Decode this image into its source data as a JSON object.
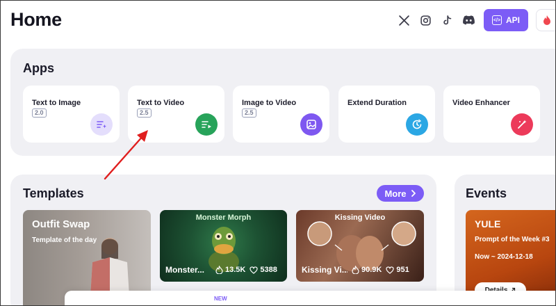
{
  "page": {
    "title": "Home"
  },
  "header": {
    "socials": [
      {
        "name": "x-icon"
      },
      {
        "name": "instagram-icon"
      },
      {
        "name": "tiktok-icon"
      },
      {
        "name": "discord-icon"
      }
    ],
    "api_label": "API"
  },
  "apps": {
    "title": "Apps",
    "items": [
      {
        "label": "Text to Image",
        "version": "2.0",
        "icon": "text-image-icon",
        "color": "#e4defc"
      },
      {
        "label": "Text to Video",
        "version": "2.5",
        "icon": "text-video-icon",
        "color": "#27a35a"
      },
      {
        "label": "Image to Video",
        "version": "2.5",
        "icon": "image-video-icon",
        "color": "#7e58f0"
      },
      {
        "label": "Extend Duration",
        "version": "",
        "icon": "extend-icon",
        "color": "#2ba7e4"
      },
      {
        "label": "Video Enhancer",
        "version": "",
        "icon": "enhance-icon",
        "color": "#ec3a5a"
      }
    ]
  },
  "templates": {
    "title": "Templates",
    "more_label": "More",
    "featured": {
      "title": "Outfit Swap",
      "subtitle": "Template of the day"
    },
    "cards": [
      {
        "top_label": "Monster Morph",
        "name": "Monster...",
        "views": "13.5K",
        "likes": "5388"
      },
      {
        "top_label": "Kissing Video",
        "name": "Kissing Vi...",
        "views": "90.9K",
        "likes": "951"
      }
    ]
  },
  "events": {
    "title": "Events",
    "card": {
      "title": "YULE",
      "subtitle": "Prompt of the Week #3",
      "date": "Now ~ 2024-12-18",
      "details_label": "Details"
    }
  },
  "bottom": {
    "new_label": "NEW"
  },
  "colors": {
    "accent": "#7c5cf6",
    "panel": "#f0f0f4",
    "annotation": "#e01e1e"
  }
}
